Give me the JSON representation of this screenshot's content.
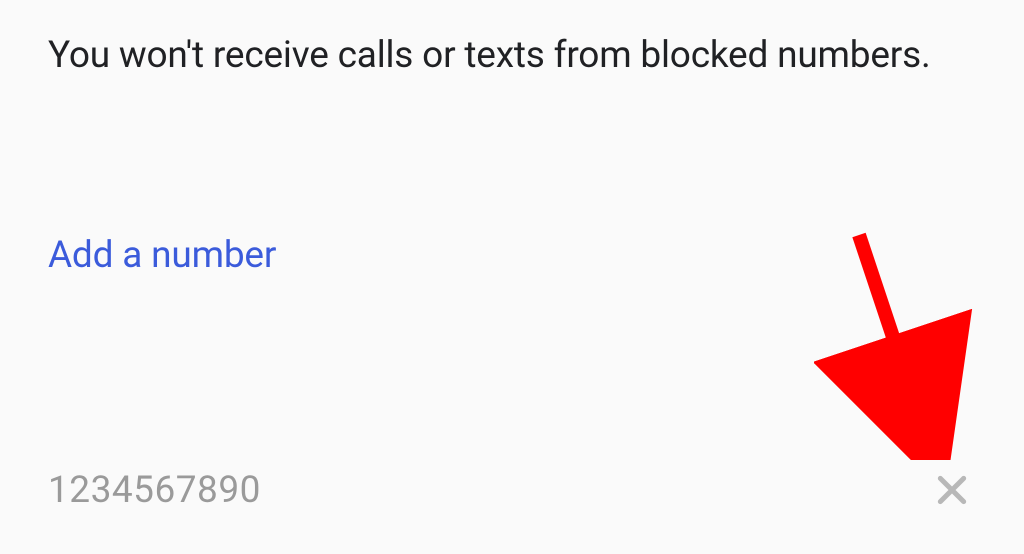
{
  "description": "You won't receive calls or texts from blocked numbers.",
  "add_number_label": "Add a number",
  "blocked_numbers": [
    {
      "number": "1234567890"
    }
  ],
  "annotation": {
    "arrow_color": "#ff0000"
  }
}
